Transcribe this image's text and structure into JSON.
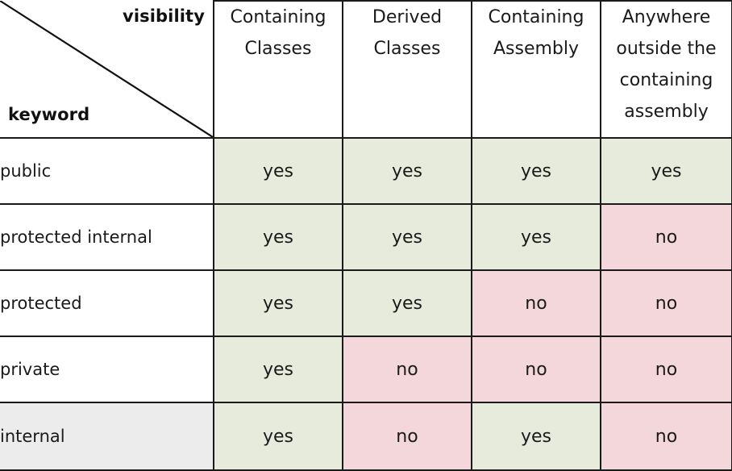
{
  "table": {
    "corner": {
      "column_axis_label": "visibility",
      "row_axis_label": "keyword",
      "diagonal_icon": "diagonal-divider-icon"
    },
    "column_headers": [
      "Containing Classes",
      "Derived Classes",
      "Containing Assembly",
      "Anywhere outside the containing assembly"
    ],
    "rows": [
      {
        "keyword": "public",
        "values": [
          "yes",
          "yes",
          "yes",
          "yes"
        ],
        "highlighted": false
      },
      {
        "keyword": "protected internal",
        "values": [
          "yes",
          "yes",
          "yes",
          "no"
        ],
        "highlighted": false
      },
      {
        "keyword": "protected",
        "values": [
          "yes",
          "yes",
          "no",
          "no"
        ],
        "highlighted": false
      },
      {
        "keyword": "private",
        "values": [
          "yes",
          "no",
          "no",
          "no"
        ],
        "highlighted": false
      },
      {
        "keyword": "internal",
        "values": [
          "yes",
          "no",
          "yes",
          "no"
        ],
        "highlighted": true
      }
    ]
  },
  "colors": {
    "yes_cell": "#e7ebdb",
    "no_cell": "#f3d7da",
    "border": "#1a1a1a",
    "background": "#ffffff",
    "row_label_highlight": "#ececec",
    "text": "#1a1a1a"
  }
}
